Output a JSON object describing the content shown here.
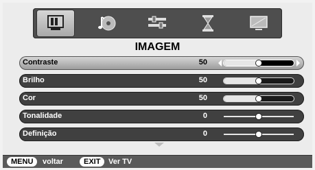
{
  "menu": {
    "title": "IMAGEM",
    "icons": [
      {
        "name": "picture-icon",
        "active": true
      },
      {
        "name": "sound-icon",
        "active": false
      },
      {
        "name": "settings-icon",
        "active": false
      },
      {
        "name": "timer-icon",
        "active": false
      },
      {
        "name": "screen-icon",
        "active": false
      }
    ],
    "items": [
      {
        "label": "Contraste",
        "value": "50",
        "level": 0.5,
        "type": "bar",
        "selected": true
      },
      {
        "label": "Brilho",
        "value": "50",
        "level": 0.5,
        "type": "bar",
        "selected": false
      },
      {
        "label": "Cor",
        "value": "50",
        "level": 0.5,
        "type": "bar",
        "selected": false
      },
      {
        "label": "Tonalidade",
        "value": "0",
        "level": 0.5,
        "type": "center",
        "selected": false
      },
      {
        "label": "Definição",
        "value": "0",
        "level": 0.5,
        "type": "center",
        "selected": false
      }
    ]
  },
  "footer": {
    "menu_key": "MENU",
    "menu_action": "voltar",
    "exit_key": "EXIT",
    "exit_action": "Ver TV"
  },
  "colors": {
    "row_bg": "#404040",
    "selected_bg": "#b8b8b8",
    "footer_bg": "#5a5a5a"
  }
}
